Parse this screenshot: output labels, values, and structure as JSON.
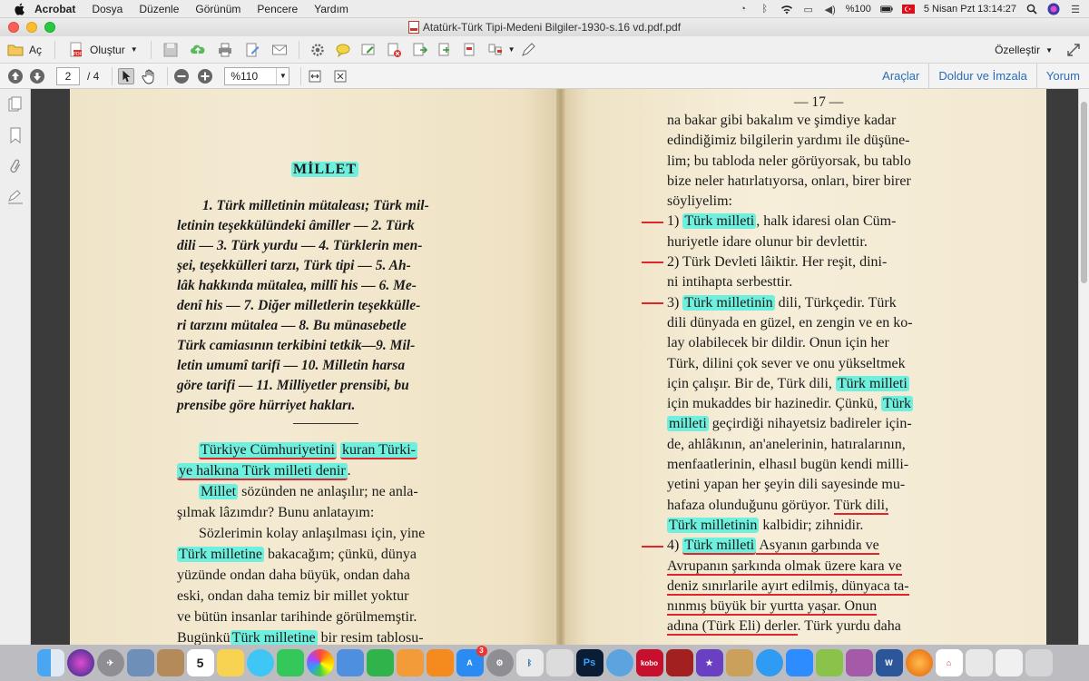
{
  "menubar": {
    "app_name": "Acrobat",
    "items": [
      "Dosya",
      "Düzenle",
      "Görünüm",
      "Pencere",
      "Yardım"
    ],
    "status": {
      "battery": "%100",
      "datetime": "5 Nisan Pzt  13:14:27"
    }
  },
  "window": {
    "title": "Atatürk-Türk Tipi-Medeni Bilgiler-1930-s.16 vd.pdf.pdf"
  },
  "toolbar": {
    "open_label": "Aç",
    "create_label": "Oluştur",
    "customize_label": "Özelleştir"
  },
  "nav": {
    "current_page": "2",
    "total_pages": "/ 4",
    "zoom": "%110",
    "tools_label": "Araçlar",
    "fill_sign_label": "Doldur ve İmzala",
    "comment_label": "Yorum"
  },
  "document": {
    "left": {
      "heading": "MİLLET",
      "summary": [
        "1. Türk milletinin mütaleası; Türk mil-",
        "letinin  teşekkülündeki âmiller — 2. Türk",
        "dili — 3. Türk yurdu — 4. Türklerin men-",
        "şei, teşekkülleri tarzı,  Türk tipi — 5. Ah-",
        "lâk hakkında mütalea,  millî his — 6. Me-",
        "denî his — 7. Diğer milletlerin teşekkülle-",
        "ri  tarzını  mütalea — 8. Bu  münasebetle",
        "Türk camiasının terkibini tetkik—9. Mil-",
        "letin  umumî tarifi — 10. Milletin  harsa",
        "göre tarifi — 11.  Milliyetler  prensibi, bu",
        "prensibe göre hürriyet hakları."
      ],
      "p1_a": "Türkiye Cümhuriyetini",
      "p1_b": "kuran Türki-",
      "p1_c": "ye halkına Türk milleti denir",
      "p1_d": ".",
      "p2_a": "Millet",
      "p2_b": " sözünden ne anlaşılır; ne anla-",
      "p2_c": "şılmak lâzımdır? Bunu anlatayım:",
      "p3_a": "Sözlerimin kolay anlaşılması için, yine",
      "p3_b": "Türk milletine",
      "p3_c": " bakacağım;  çünkü, dünya",
      "p3_d": "yüzünde ondan   daha büyük,  ondan daha",
      "p3_e": "eski, ondan daha temiz bir millet  yoktur",
      "p3_f": "ve bütün insanlar tarihinde görülmemştir.",
      "p3_g": "Bugünkü",
      "p3_h": "Türk milletine",
      "p3_i": " bir resim tablosu-"
    },
    "right": {
      "page_number": "— 17 —",
      "l1": "na bakar gibi   bakalım ve şimdiye  kadar",
      "l2": "edindiğimiz bilgilerin yardımı ile düşüne-",
      "l3": "lim; bu tabloda neler görüyorsak, bu tablo",
      "l4": "bize neler hatırlatıyorsa, onları, birer birer",
      "l5": "söyliyelim:",
      "i1_num": "1)",
      "i1_hl": "Türk milleti",
      "i1_rest": ", halk idaresi olan Cüm-",
      "i1_l2": "huriyetle idare olunur bir devlettir.",
      "i2_a": "2) Türk Devleti lâiktir. Her reşit, dini-",
      "i2_b": "ni intihapta serbesttir.",
      "i3_num": "3)",
      "i3_hl": "Türk milletinin",
      "i3_rest": " dili, Türkçedir. Türk",
      "i3_l2": "dili dünyada en güzel, en zengin ve en ko-",
      "i3_l3": "lay olabilecek  bir dildir.  Onun  için her",
      "i3_l4": "Türk, dilini çok sever ve onu  yükseltmek",
      "i3_l5a": "için çalışır. Bir de, Türk dili,",
      "i3_l5hl": "Türk milleti",
      "i3_l6a": "için mukaddes bir hazinedir. Çünkü,",
      "i3_l6hl": "Türk",
      "i3_l7hl": "milleti",
      "i3_l7b": " geçirdiği nihayetsiz badireler için-",
      "i3_l8": "de, ahlâkının, an'anelerinin, hatıralarının,",
      "i3_l9": "menfaatlerinin, elhasıl bugün kendi milli-",
      "i3_l10": "yetini yapan her şeyin dili sayesinde mu-",
      "i3_l11a": "hafaza olunduğunu görüyor.",
      "i3_l11b": "Türk dili,",
      "i3_l12hl": "Türk milletinin",
      "i3_l12b": " kalbidir; zihnidir.",
      "i4_num": "4)",
      "i4_hl": "Türk milleti",
      "i4_rest": "  Asyanın  garbında ve",
      "i4_l2": "Avrupanın şarkında olmak üzere kara ve",
      "i4_l3": "deniz sınırlarile ayırt edilmiş, dünyaca ta-",
      "i4_l4": "nınmış  büyük bir  yurtta  yaşar.  Onun",
      "i4_l5a": "adına (Türk Eli) derler",
      "i4_l5b": ". Türk yurdu daha"
    }
  },
  "dock": {
    "calendar_day": "5",
    "appstore_badge": "3",
    "ps_label": "Ps",
    "kobo_label": "kobo"
  },
  "colors": {
    "highlight": "#6ff0de",
    "underline": "#e0262c",
    "paper": "#f5ecd7",
    "link_blue": "#2a6db8"
  }
}
